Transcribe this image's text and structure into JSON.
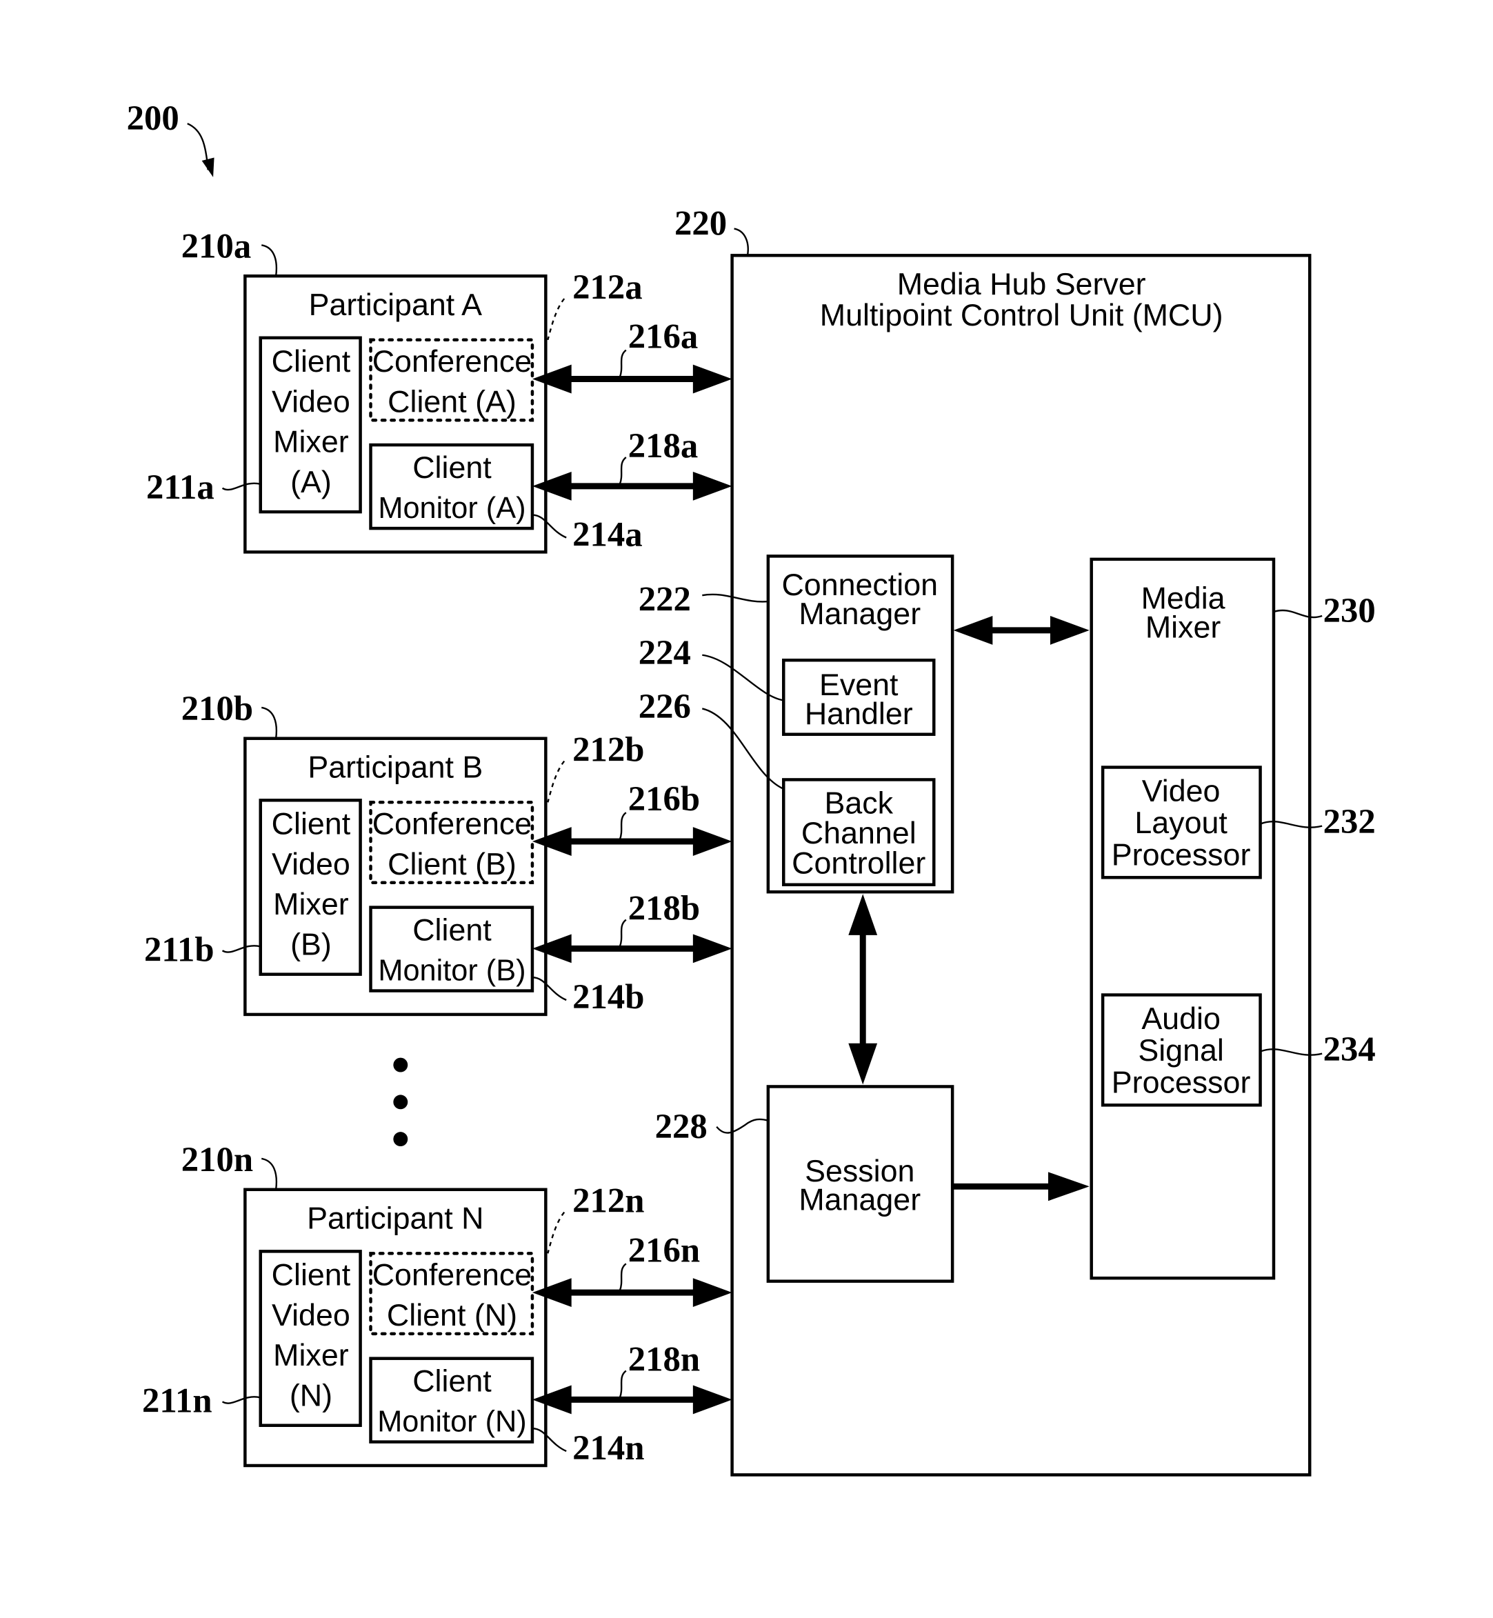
{
  "figure": {
    "ref": "200"
  },
  "participants": [
    {
      "ref": "210a",
      "title": "Participant A",
      "mixer": {
        "ref": "211a",
        "lines": [
          "Client",
          "Video",
          "Mixer",
          "(A)"
        ]
      },
      "conference_client": {
        "ref": "212a",
        "lines": [
          "Conference",
          "Client (A)"
        ]
      },
      "client_monitor": {
        "ref": "214a",
        "lines": [
          "Client",
          "Monitor (A)"
        ]
      },
      "link_top_ref": "216a",
      "link_bottom_ref": "218a"
    },
    {
      "ref": "210b",
      "title": "Participant B",
      "mixer": {
        "ref": "211b",
        "lines": [
          "Client",
          "Video",
          "Mixer",
          "(B)"
        ]
      },
      "conference_client": {
        "ref": "212b",
        "lines": [
          "Conference",
          "Client (B)"
        ]
      },
      "client_monitor": {
        "ref": "214b",
        "lines": [
          "Client",
          "Monitor (B)"
        ]
      },
      "link_top_ref": "216b",
      "link_bottom_ref": "218b"
    },
    {
      "ref": "210n",
      "title": "Participant N",
      "mixer": {
        "ref": "211n",
        "lines": [
          "Client",
          "Video",
          "Mixer",
          "(N)"
        ]
      },
      "conference_client": {
        "ref": "212n",
        "lines": [
          "Conference",
          "Client (N)"
        ]
      },
      "client_monitor": {
        "ref": "214n",
        "lines": [
          "Client",
          "Monitor (N)"
        ]
      },
      "link_top_ref": "216n",
      "link_bottom_ref": "218n"
    }
  ],
  "server": {
    "ref": "220",
    "title_lines": [
      "Media Hub Server",
      "Multipoint Control Unit (MCU)"
    ],
    "connection_manager": {
      "ref": "222",
      "lines": [
        "Connection",
        "Manager"
      ]
    },
    "event_handler": {
      "ref": "224",
      "lines": [
        "Event",
        "Handler"
      ]
    },
    "back_channel_controller": {
      "ref": "226",
      "lines": [
        "Back",
        "Channel",
        "Controller"
      ]
    },
    "session_manager": {
      "ref": "228",
      "lines": [
        "Session",
        "Manager"
      ]
    },
    "media_mixer": {
      "ref": "230",
      "lines": [
        "Media",
        "Mixer"
      ]
    },
    "video_layout_processor": {
      "ref": "232",
      "lines": [
        "Video",
        "Layout",
        "Processor"
      ]
    },
    "audio_signal_processor": {
      "ref": "234",
      "lines": [
        "Audio",
        "Signal",
        "Processor"
      ]
    }
  }
}
